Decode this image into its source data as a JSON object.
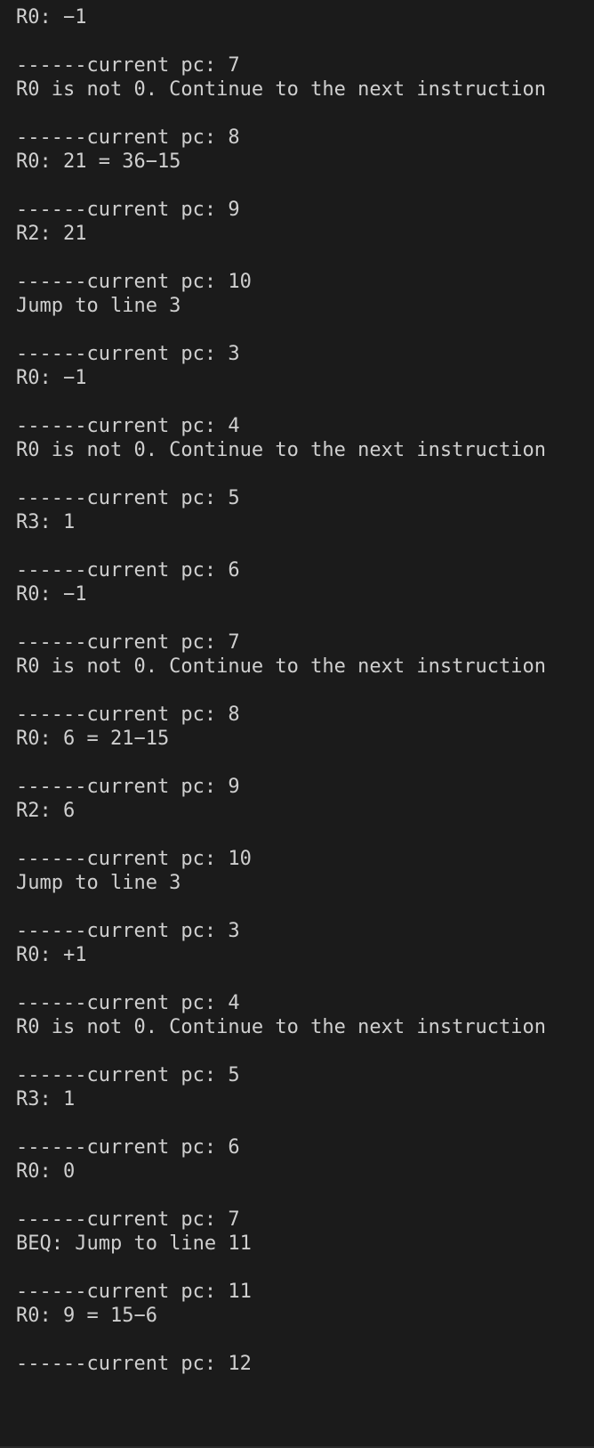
{
  "terminal": {
    "first_line": "R0: −1",
    "entries": [
      {
        "header": "------current pc: 7",
        "message": "R0 is not 0. Continue to the next instruction"
      },
      {
        "header": "------current pc: 8",
        "message": "R0: 21 = 36−15"
      },
      {
        "header": "------current pc: 9",
        "message": "R2: 21"
      },
      {
        "header": "------current pc: 10",
        "message": "Jump to line 3"
      },
      {
        "header": "------current pc: 3",
        "message": "R0: −1"
      },
      {
        "header": "------current pc: 4",
        "message": "R0 is not 0. Continue to the next instruction"
      },
      {
        "header": "------current pc: 5",
        "message": "R3: 1"
      },
      {
        "header": "------current pc: 6",
        "message": "R0: −1"
      },
      {
        "header": "------current pc: 7",
        "message": "R0 is not 0. Continue to the next instruction"
      },
      {
        "header": "------current pc: 8",
        "message": "R0: 6 = 21−15"
      },
      {
        "header": "------current pc: 9",
        "message": "R2: 6"
      },
      {
        "header": "------current pc: 10",
        "message": "Jump to line 3"
      },
      {
        "header": "------current pc: 3",
        "message": "R0: +1"
      },
      {
        "header": "------current pc: 4",
        "message": "R0 is not 0. Continue to the next instruction"
      },
      {
        "header": "------current pc: 5",
        "message": "R3: 1"
      },
      {
        "header": "------current pc: 6",
        "message": "R0: 0"
      },
      {
        "header": "------current pc: 7",
        "message": "BEQ: Jump to line 11"
      },
      {
        "header": "------current pc: 11",
        "message": "R0: 9 = 15−6"
      }
    ],
    "last_line": "------current pc: 12"
  }
}
